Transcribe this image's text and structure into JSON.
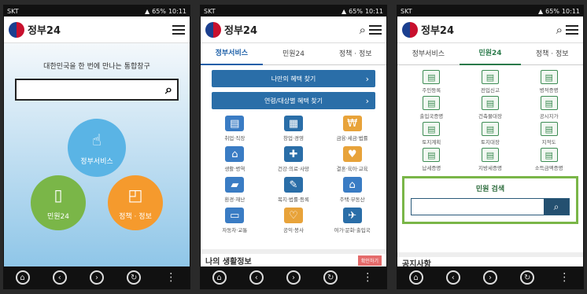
{
  "status": {
    "carrier1": "SKT",
    "carrier2": "SKT",
    "carrier3": "SKT",
    "battery": "65%",
    "time": "10:11"
  },
  "app": {
    "title": "정부24"
  },
  "screen1": {
    "tagline": "대한민국을 한 번에 만나는 통합창구",
    "search_placeholder": "",
    "circles": {
      "gov": "정부서비스",
      "min": "민원24",
      "pol": "정책 · 정보"
    }
  },
  "tabs": [
    "정부서비스",
    "민원24",
    "정책 · 정보"
  ],
  "screen2": {
    "btn1": "나만의 혜택 찾기",
    "btn2": "연령/대상별 혜택 찾기",
    "items": [
      "취업·직장",
      "창업·경영",
      "금융·세금·법률",
      "생활·병역",
      "건강·의료·사망",
      "결혼·육아·교육",
      "환경·재난",
      "복지·법률·등록",
      "주택·부동산",
      "자동차·교통",
      "공익·봉사",
      "여가·문화·출입국"
    ],
    "icons": [
      "briefcase-icon",
      "building-icon",
      "money-icon",
      "house-icon",
      "health-icon",
      "stroller-icon",
      "truck-icon",
      "welfare-icon",
      "home-icon",
      "car-icon",
      "heart-icon",
      "leisure-icon"
    ],
    "colors": [
      "#3a7cc4",
      "#2a6ea8",
      "#e8a33a",
      "#3a7cc4",
      "#2a6ea8",
      "#e8a33a",
      "#3a7cc4",
      "#2a6ea8",
      "#3a7cc4",
      "#3a7cc4",
      "#e8a33a",
      "#2a6ea8"
    ],
    "life_title": "나의 생활정보",
    "life_btn": "확인하기"
  },
  "screen3": {
    "items": [
      "주민등록",
      "전입신고",
      "병적증명",
      "출입국증명",
      "건축물대장",
      "공시지가",
      "토지계획",
      "토지대장",
      "지적도",
      "납세증명",
      "지방세증명",
      "소득금액증명"
    ],
    "search_title": "민원 검색",
    "notice_title": "공지사항"
  },
  "nav": {
    "home": "⌂",
    "back": "‹",
    "forward": "›",
    "refresh": "↻",
    "more": "⋮"
  }
}
